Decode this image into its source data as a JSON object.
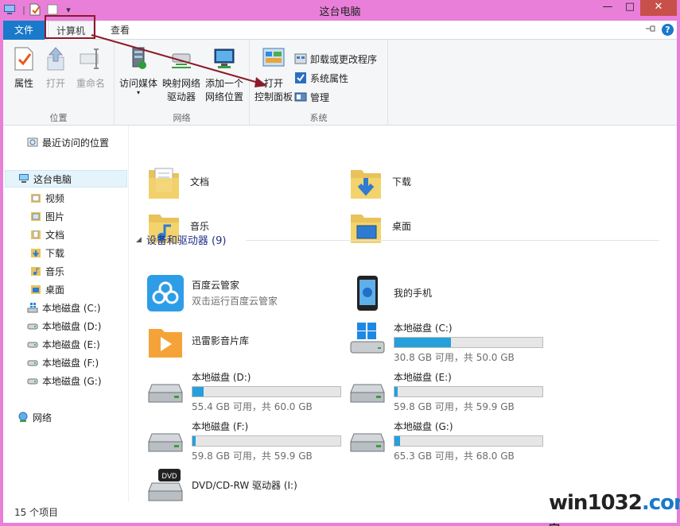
{
  "window": {
    "title": "这台电脑",
    "min_glyph": "—",
    "max_glyph": "□",
    "close_glyph": "✕"
  },
  "ribbon": {
    "tabs": [
      {
        "label": "文件"
      },
      {
        "label": "计算机"
      },
      {
        "label": "查看"
      }
    ],
    "help_glyph": "?",
    "groups": {
      "location": {
        "label": "位置",
        "properties": "属性",
        "open": "打开",
        "rename": "重命名"
      },
      "network": {
        "label": "网络",
        "access_media": "访问媒体",
        "map_drive_1": "映射网络",
        "map_drive_2": "驱动器",
        "add_location_1": "添加一个",
        "add_location_2": "网络位置"
      },
      "system": {
        "label": "系统",
        "open_cp_1": "打开",
        "open_cp_2": "控制面板",
        "uninstall": "卸载或更改程序",
        "sys_props": "系统属性",
        "manage": "管理"
      }
    }
  },
  "nav": {
    "recent": "最近访问的位置",
    "this_pc": "这台电脑",
    "items": [
      "视频",
      "图片",
      "文档",
      "下载",
      "音乐",
      "桌面"
    ],
    "drives": [
      "本地磁盘 (C:)",
      "本地磁盘 (D:)",
      "本地磁盘 (E:)",
      "本地磁盘 (F:)",
      "本地磁盘 (G:)"
    ],
    "network": "网络"
  },
  "folders": [
    "文档",
    "下载",
    "音乐",
    "桌面"
  ],
  "devices": {
    "header": "设备和驱动器 (9)",
    "baidu": {
      "name": "百度云管家",
      "sub": "双击运行百度云管家"
    },
    "phone": {
      "name": "我的手机"
    },
    "xunlei": {
      "name": "迅雷影音片库"
    },
    "drives": [
      {
        "name": "本地磁盘 (C:)",
        "info": "30.8 GB 可用，共 50.0 GB",
        "used_fraction": 0.384
      },
      {
        "name": "本地磁盘 (D:)",
        "info": "55.4 GB 可用，共 60.0 GB",
        "used_fraction": 0.077
      },
      {
        "name": "本地磁盘 (E:)",
        "info": "59.8 GB 可用，共 59.9 GB",
        "used_fraction": 0.002
      },
      {
        "name": "本地磁盘 (F:)",
        "info": "59.8 GB 可用，共 59.9 GB",
        "used_fraction": 0.002
      },
      {
        "name": "本地磁盘 (G:)",
        "info": "65.3 GB 可用，共 68.0 GB",
        "used_fraction": 0.04
      }
    ],
    "dvd": {
      "name": "DVD/CD-RW 驱动器 (I:)",
      "badge": "DVD"
    }
  },
  "status": {
    "count": "15 个项目"
  },
  "watermark": {
    "a": "win1032",
    "b": ".com",
    "c": "家"
  }
}
